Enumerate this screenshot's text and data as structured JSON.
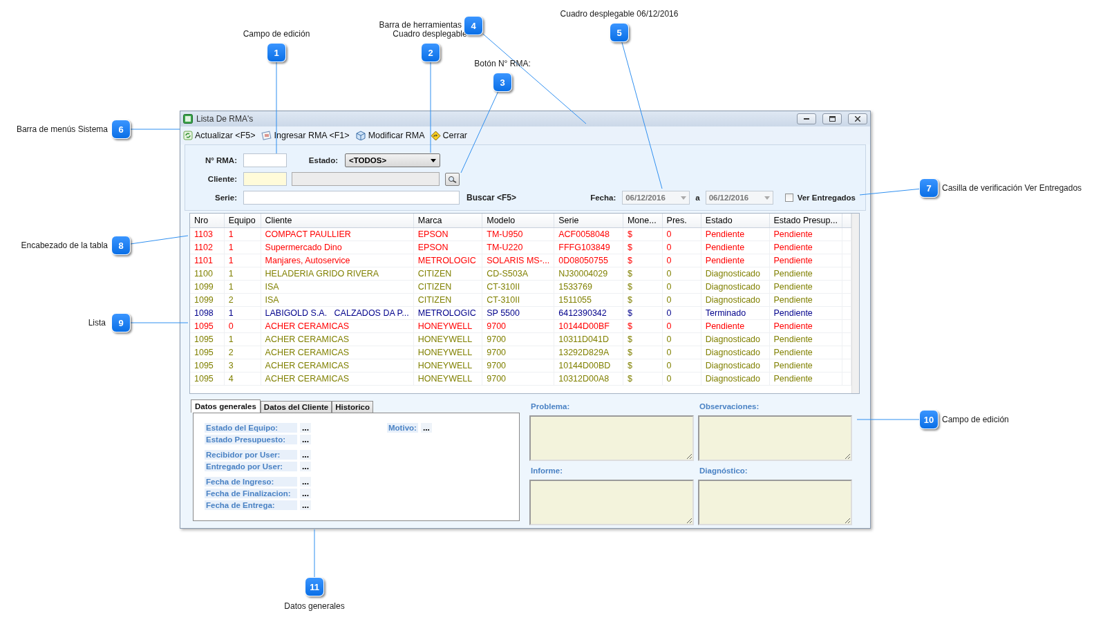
{
  "callouts": [
    {
      "number": "1",
      "label": "Campo de edición"
    },
    {
      "number": "2",
      "label": "Cuadro desplegable"
    },
    {
      "number": "3",
      "label": "Botón N° RMA:"
    },
    {
      "number": "4",
      "label": "Barra de herramientas"
    },
    {
      "number": "5",
      "label": "Cuadro desplegable 06/12/2016"
    },
    {
      "number": "6",
      "label": "Barra de menús Sistema"
    },
    {
      "number": "7",
      "label": "Casilla de verificación Ver Entregados"
    },
    {
      "number": "8",
      "label": "Encabezado de la tabla"
    },
    {
      "number": "9",
      "label": "Lista"
    },
    {
      "number": "10",
      "label": "Campo de edición"
    },
    {
      "number": "11",
      "label": "Datos generales"
    }
  ],
  "window": {
    "title": "Lista De RMA's"
  },
  "toolbar": [
    {
      "label": "Actualizar <F5>"
    },
    {
      "label": "Ingresar RMA <F1>"
    },
    {
      "label": "Modificar RMA"
    },
    {
      "label": "Cerrar"
    }
  ],
  "filters": {
    "rma_label": "N° RMA:",
    "estado_label": "Estado:",
    "estado_value": "<TODOS>",
    "cliente_label": "Cliente:",
    "serie_label": "Serie:",
    "search_label": "Buscar <F5>",
    "fecha_label": "Fecha:",
    "date_from": "06/12/2016",
    "date_separator": "a",
    "date_to": "06/12/2016",
    "ver_entregados": {
      "label": "Ver Entregados",
      "checked": false
    }
  },
  "table": {
    "columns": [
      "Nro",
      "Equipo",
      "Cliente",
      "Marca",
      "Modelo",
      "Serie",
      "Mone...",
      "Pres.",
      "Estado",
      "Estado Presup..."
    ],
    "rows": [
      {
        "color": "#ff0000",
        "cells": [
          "1103",
          "1",
          "COMPACT PAULLIER",
          "EPSON",
          "TM-U950",
          "ACF0058048",
          "$",
          "0",
          "Pendiente",
          "Pendiente"
        ]
      },
      {
        "color": "#ff0000",
        "cells": [
          "1102",
          "1",
          "Supermercado Dino",
          "EPSON",
          "TM-U220",
          "FFFG103849",
          "$",
          "0",
          "Pendiente",
          "Pendiente"
        ]
      },
      {
        "color": "#ff0000",
        "cells": [
          "1101",
          "1",
          "Manjares, Autoservice",
          "METROLOGIC",
          "SOLARIS MS-...",
          "0D08050755",
          "$",
          "0",
          "Pendiente",
          "Pendiente"
        ]
      },
      {
        "color": "#808000",
        "cells": [
          "1100",
          "1",
          "HELADERIA GRIDO RIVERA",
          "CITIZEN",
          "CD-S503A",
          "NJ30004029",
          "$",
          "0",
          "Diagnosticado",
          "Pendiente"
        ]
      },
      {
        "color": "#808000",
        "cells": [
          "1099",
          "1",
          "ISA",
          "CITIZEN",
          "CT-310II",
          "1533769",
          "$",
          "0",
          "Diagnosticado",
          "Pendiente"
        ]
      },
      {
        "color": "#808000",
        "cells": [
          "1099",
          "2",
          "ISA",
          "CITIZEN",
          "CT-310II",
          "1511055",
          "$",
          "0",
          "Diagnosticado",
          "Pendiente"
        ]
      },
      {
        "color": "#00008b",
        "cells": [
          "1098",
          "1",
          "LABIGOLD S.A.   CALZADOS DA P...",
          "METROLOGIC",
          "SP 5500",
          "6412390342",
          "$",
          "0",
          "Terminado",
          "Pendiente"
        ]
      },
      {
        "color": "#ff0000",
        "cells": [
          "1095",
          "0",
          "ACHER CERAMICAS",
          "HONEYWELL",
          "9700",
          "10144D00BF",
          "$",
          "0",
          "Pendiente",
          "Pendiente"
        ]
      },
      {
        "color": "#808000",
        "cells": [
          "1095",
          "1",
          "ACHER CERAMICAS",
          "HONEYWELL",
          "9700",
          "10311D041D",
          "$",
          "0",
          "Diagnosticado",
          "Pendiente"
        ]
      },
      {
        "color": "#808000",
        "cells": [
          "1095",
          "2",
          "ACHER CERAMICAS",
          "HONEYWELL",
          "9700",
          "13292D829A",
          "$",
          "0",
          "Diagnosticado",
          "Pendiente"
        ]
      },
      {
        "color": "#808000",
        "cells": [
          "1095",
          "3",
          "ACHER CERAMICAS",
          "HONEYWELL",
          "9700",
          "10144D00BD",
          "$",
          "0",
          "Diagnosticado",
          "Pendiente"
        ]
      },
      {
        "color": "#808000",
        "cells": [
          "1095",
          "4",
          "ACHER CERAMICAS",
          "HONEYWELL",
          "9700",
          "10312D00A8",
          "$",
          "0",
          "Diagnosticado",
          "Pendiente"
        ]
      }
    ]
  },
  "tabs": [
    {
      "label": "Datos generales",
      "selected": true
    },
    {
      "label": "Datos del Cliente",
      "selected": false
    },
    {
      "label": "Historico",
      "selected": false
    }
  ],
  "details": {
    "groups": [
      [
        {
          "label": "Estado del Equipo:",
          "value": "..."
        },
        {
          "label": "Estado Presupuesto:",
          "value": "..."
        }
      ],
      [
        {
          "label": "Recibidor por User:",
          "value": "..."
        },
        {
          "label": "Entregado por User:",
          "value": "..."
        }
      ],
      [
        {
          "label": "Fecha de Ingreso:",
          "value": "..."
        },
        {
          "label": "Fecha de Finalizacion:",
          "value": "..."
        },
        {
          "label": "Fecha de Entrega:",
          "value": "..."
        }
      ]
    ],
    "motivo": {
      "label": "Motivo:",
      "value": "..."
    }
  },
  "notes": [
    {
      "label": "Problema:"
    },
    {
      "label": "Observaciones:"
    },
    {
      "label": "Informe:"
    },
    {
      "label": "Diagnóstico:"
    }
  ]
}
